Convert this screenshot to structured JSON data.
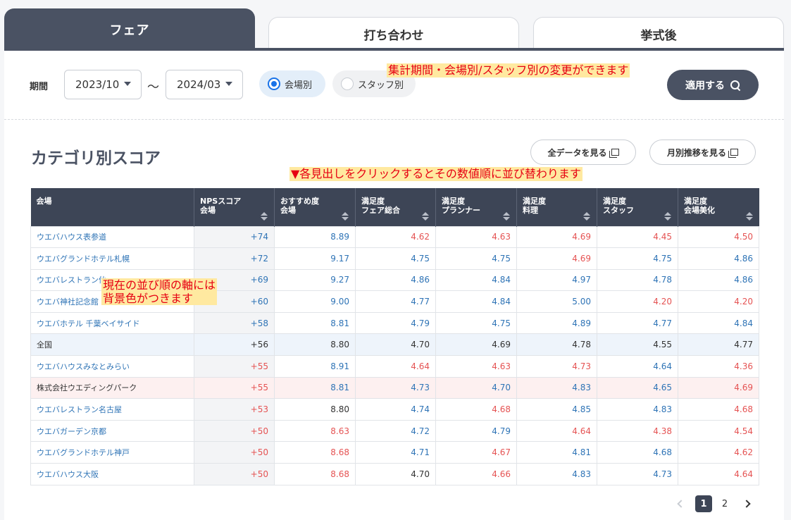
{
  "tabs": [
    {
      "label": "フェア"
    },
    {
      "label": "打ち合わせ"
    },
    {
      "label": "挙式後"
    }
  ],
  "filters": {
    "period_label": "期間",
    "from": "2023/10",
    "separator": "～",
    "to": "2024/03",
    "radio_venue": "会場別",
    "radio_staff": "スタッフ別",
    "apply_label": "適用する"
  },
  "annotations": {
    "filter_note": "集計期間・会場別/スタッフ別の変更ができます",
    "sort_note": "▼各見出しをクリックするとその数値順に並び替わります",
    "bg_note_line1": "現在の並び順の軸には",
    "bg_note_line2": "背景色がつきます"
  },
  "section": {
    "title": "カテゴリ別スコア",
    "btn_all": "全データを見る",
    "btn_monthly": "月別推移を見る"
  },
  "table": {
    "headers": [
      {
        "l1": "会場",
        "l2": ""
      },
      {
        "l1": "NPSスコア",
        "l2": "会場"
      },
      {
        "l1": "おすすめ度",
        "l2": "会場"
      },
      {
        "l1": "満足度",
        "l2": "フェア総合"
      },
      {
        "l1": "満足度",
        "l2": "プランナー"
      },
      {
        "l1": "満足度",
        "l2": "料理"
      },
      {
        "l1": "満足度",
        "l2": "スタッフ"
      },
      {
        "l1": "満足度",
        "l2": "会場美化"
      }
    ],
    "rows": [
      {
        "type": "",
        "cells": [
          "ウエバハウス表参道",
          "+74",
          "8.89",
          "4.62",
          "4.63",
          "4.69",
          "4.45",
          "4.50"
        ],
        "colors": [
          "",
          "blue",
          "blue",
          "red",
          "red",
          "red",
          "red",
          "red"
        ]
      },
      {
        "type": "",
        "cells": [
          "ウエバグランドホテル札幌",
          "+72",
          "9.17",
          "4.75",
          "4.75",
          "4.69",
          "4.75",
          "4.86"
        ],
        "colors": [
          "",
          "blue",
          "blue",
          "blue",
          "blue",
          "red",
          "blue",
          "blue"
        ]
      },
      {
        "type": "",
        "cells": [
          "ウエバレストラン仙",
          "+69",
          "9.27",
          "4.86",
          "4.84",
          "4.97",
          "4.78",
          "4.86"
        ],
        "colors": [
          "",
          "blue",
          "blue",
          "blue",
          "blue",
          "blue",
          "blue",
          "blue"
        ]
      },
      {
        "type": "",
        "cells": [
          "ウエバ神社記念館",
          "+60",
          "9.00",
          "4.77",
          "4.84",
          "5.00",
          "4.20",
          "4.20"
        ],
        "colors": [
          "",
          "blue",
          "blue",
          "blue",
          "blue",
          "blue",
          "red",
          "red"
        ]
      },
      {
        "type": "",
        "cells": [
          "ウエバホテル 千葉ベイサイド",
          "+58",
          "8.81",
          "4.79",
          "4.75",
          "4.89",
          "4.77",
          "4.84"
        ],
        "colors": [
          "",
          "blue",
          "blue",
          "blue",
          "blue",
          "blue",
          "blue",
          "blue"
        ]
      },
      {
        "type": "national",
        "cells": [
          "全国",
          "+56",
          "8.80",
          "4.70",
          "4.69",
          "4.78",
          "4.55",
          "4.77"
        ],
        "colors": [
          "",
          "black",
          "black",
          "black",
          "black",
          "black",
          "black",
          "black"
        ]
      },
      {
        "type": "",
        "cells": [
          "ウエバハウスみなとみらい",
          "+55",
          "8.91",
          "4.64",
          "4.63",
          "4.73",
          "4.64",
          "4.36"
        ],
        "colors": [
          "",
          "red",
          "blue",
          "red",
          "red",
          "red",
          "blue",
          "red"
        ]
      },
      {
        "type": "self",
        "cells": [
          "株式会社ウエディングパーク",
          "+55",
          "8.81",
          "4.73",
          "4.70",
          "4.83",
          "4.65",
          "4.69"
        ],
        "colors": [
          "",
          "red",
          "blue",
          "blue",
          "blue",
          "blue",
          "blue",
          "red"
        ]
      },
      {
        "type": "",
        "cells": [
          "ウエバレストラン名古屋",
          "+53",
          "8.80",
          "4.74",
          "4.68",
          "4.85",
          "4.83",
          "4.68"
        ],
        "colors": [
          "",
          "red",
          "black",
          "blue",
          "red",
          "blue",
          "blue",
          "red"
        ]
      },
      {
        "type": "",
        "cells": [
          "ウエバガーデン京都",
          "+50",
          "8.63",
          "4.72",
          "4.79",
          "4.64",
          "4.38",
          "4.54"
        ],
        "colors": [
          "",
          "red",
          "red",
          "blue",
          "blue",
          "red",
          "red",
          "red"
        ]
      },
      {
        "type": "",
        "cells": [
          "ウエバグランドホテル神戸",
          "+50",
          "8.68",
          "4.71",
          "4.67",
          "4.81",
          "4.68",
          "4.62"
        ],
        "colors": [
          "",
          "red",
          "red",
          "blue",
          "red",
          "blue",
          "blue",
          "red"
        ]
      },
      {
        "type": "",
        "cells": [
          "ウエバハウス大阪",
          "+50",
          "8.68",
          "4.70",
          "4.66",
          "4.83",
          "4.73",
          "4.64"
        ],
        "colors": [
          "",
          "red",
          "red",
          "black",
          "red",
          "blue",
          "blue",
          "red"
        ]
      }
    ]
  },
  "pagination": {
    "pages": [
      "1",
      "2"
    ],
    "current": "1"
  },
  "colors": {
    "dark": "#4a5263",
    "header": "#3d4556",
    "blue": "#2f74b6",
    "red": "#e55353",
    "note_bg": "#ffe9a0",
    "note_text": "#e60012"
  }
}
